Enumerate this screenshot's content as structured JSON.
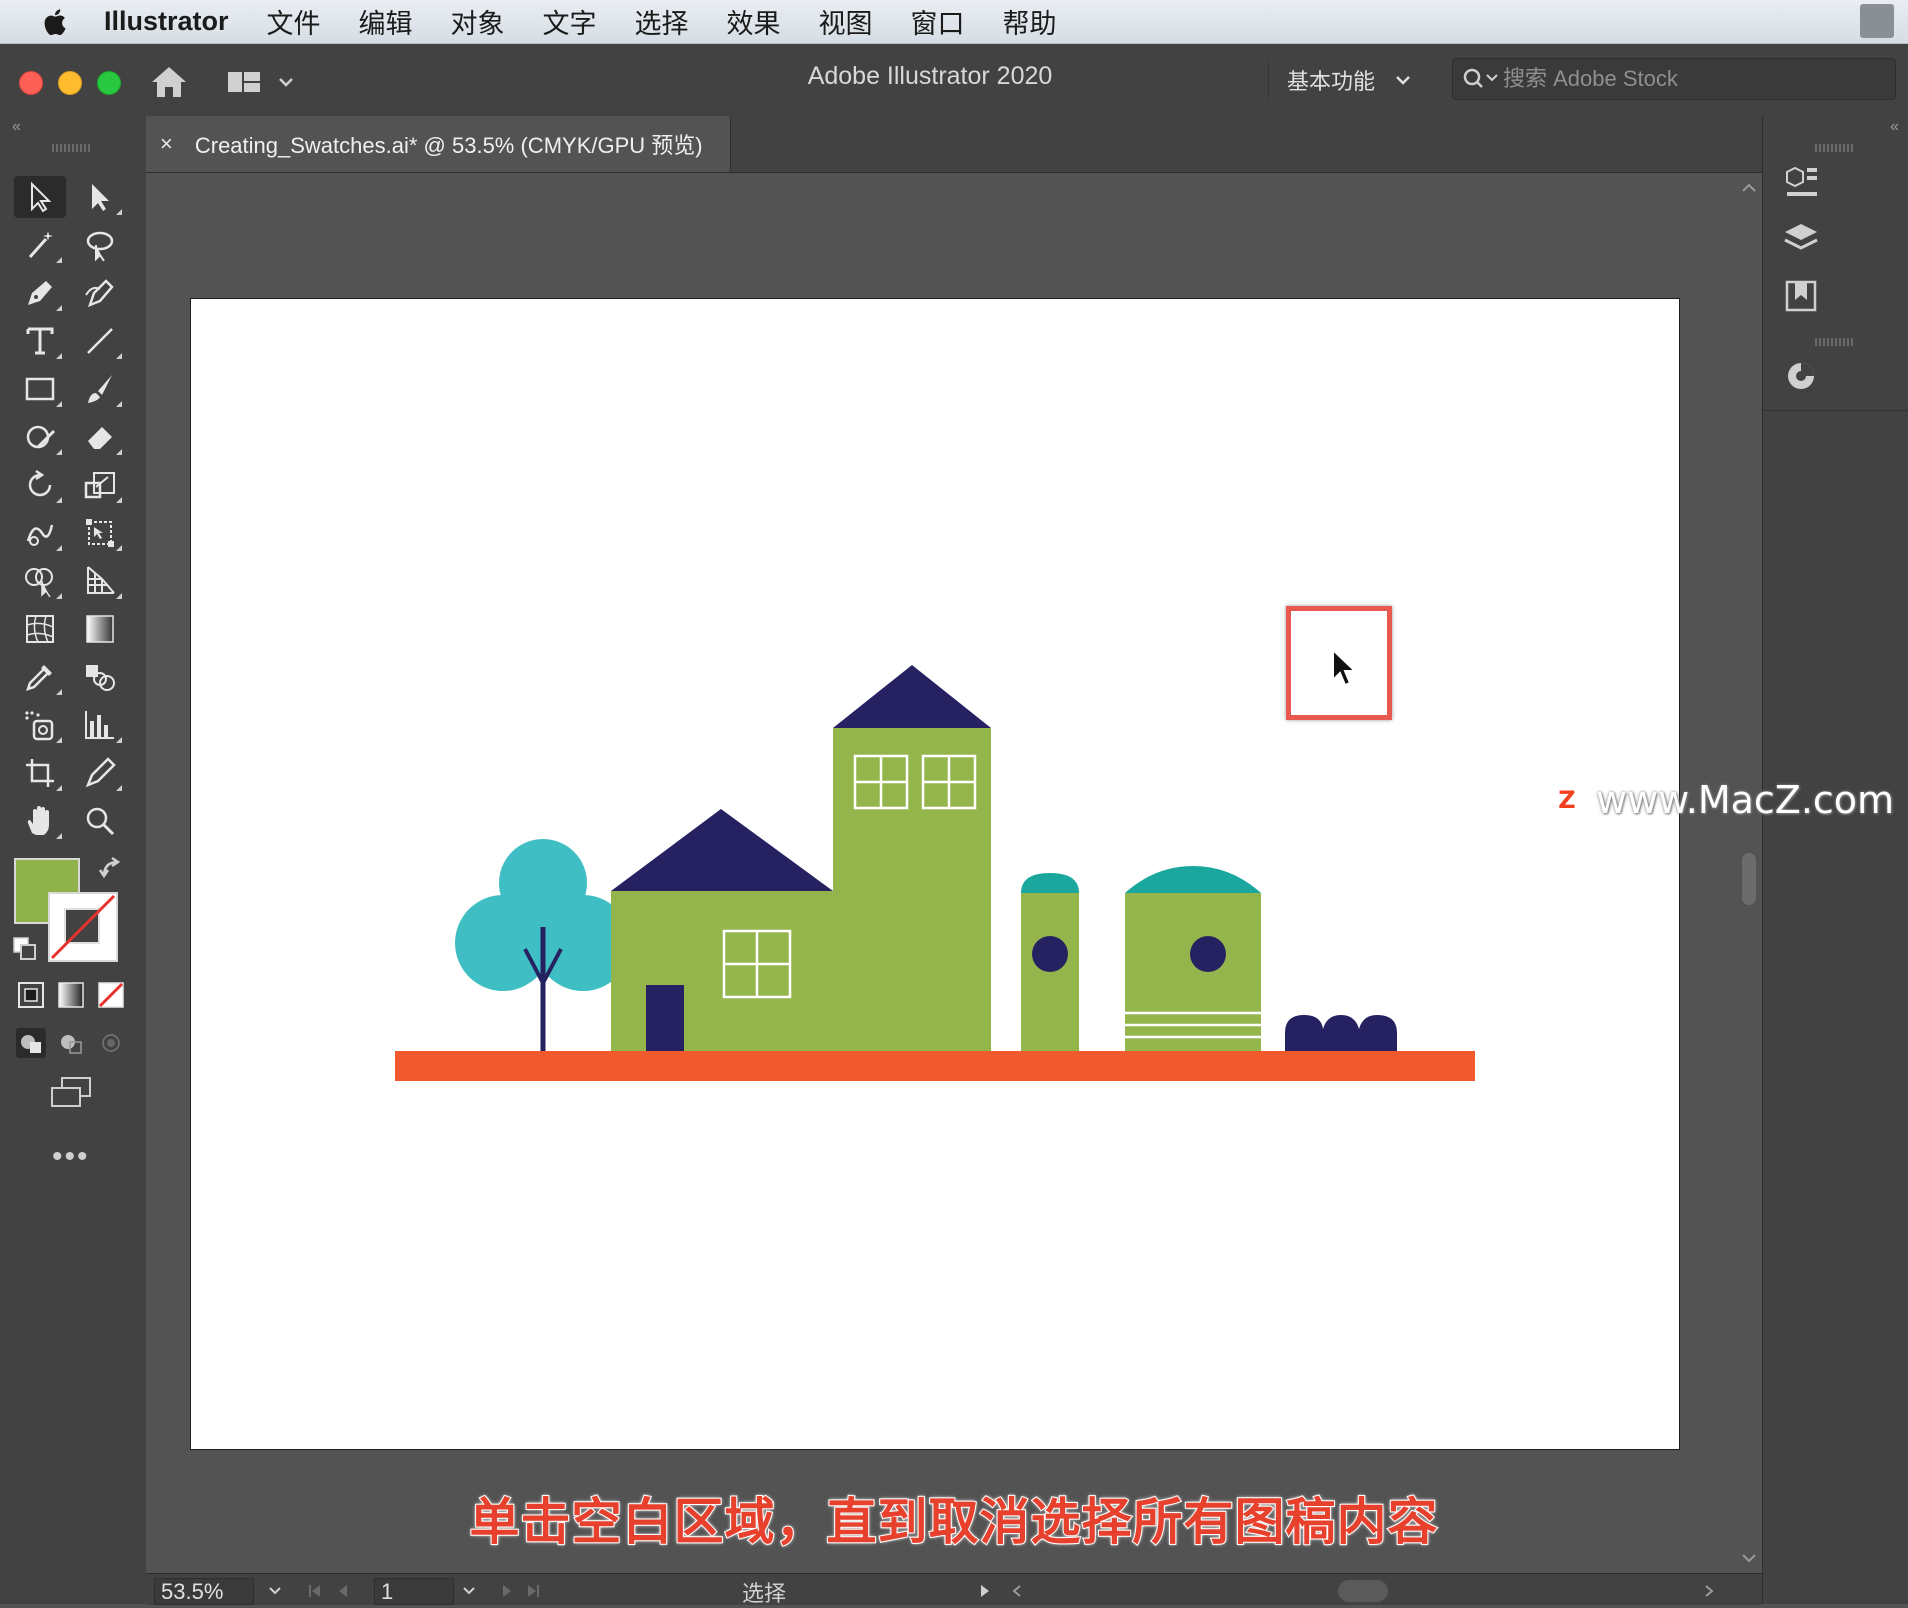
{
  "menubar": {
    "items": [
      "Illustrator",
      "文件",
      "编辑",
      "对象",
      "文字",
      "选择",
      "效果",
      "视图",
      "窗口",
      "帮助"
    ]
  },
  "titlebar": {
    "title": "Adobe Illustrator 2020",
    "workspace": "基本功能",
    "stock_search_placeholder": "搜索 Adobe Stock"
  },
  "document_tab": {
    "close": "×",
    "label": "Creating_Swatches.ai* @ 53.5% (CMYK/GPU 预览)"
  },
  "toolbar": {
    "fill_color": "#8fb34a",
    "stroke": "none",
    "more": "•••"
  },
  "artwork": {
    "colors": {
      "green": "#93b54b",
      "navy": "#262261",
      "teal": "#3fbfc3",
      "dome": "#1aa89e",
      "orange": "#f05a2c"
    }
  },
  "statusbar": {
    "zoom": "53.5%",
    "page": "1",
    "current_tool": "选择"
  },
  "overlay": {
    "watermark_logo": "Z",
    "watermark": "www.MacZ.com",
    "subtitle": "单击空白区域，直到取消选择所有图稿内容"
  }
}
